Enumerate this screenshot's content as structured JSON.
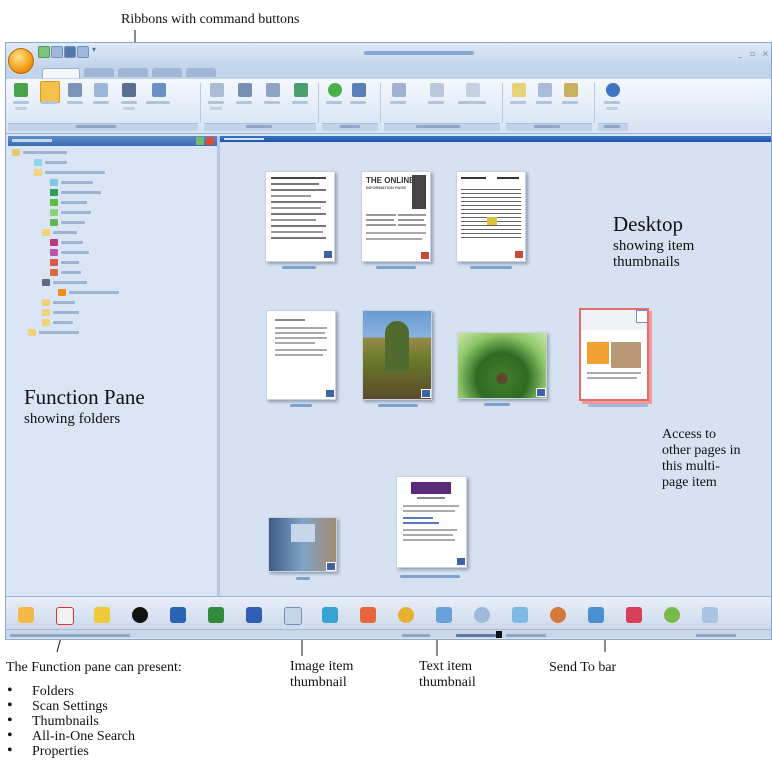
{
  "callouts": {
    "ribbons": "Ribbons with command buttons",
    "desktop_title": "Desktop",
    "desktop_sub1": "showing item",
    "desktop_sub2": "thumbnails",
    "function_pane_title": "Function Pane",
    "function_pane_sub": "showing folders",
    "access_line1": "Access to",
    "access_line2": "other pages in",
    "access_line3": "this multi-",
    "access_line4": "page item",
    "image_item_1": "Image item",
    "image_item_2": "thumbnail",
    "text_item_1": "Text item",
    "text_item_2": "thumbnail",
    "send_to_bar": "Send To bar"
  },
  "function_pane_can_present": {
    "heading": "The Function pane can present:",
    "items": [
      "Folders",
      "Scan Settings",
      "Thumbnails",
      "All-in-One Search",
      "Properties"
    ]
  },
  "thumbnails": {
    "newsletter_headline_1": "THE ONLINE",
    "newsletter_headline_2": "INFORMATION PAGE"
  },
  "colors": {
    "window_bg": "#dde7f4",
    "title_accent": "#3b6db4",
    "orb": "#f39a12",
    "multipage_border": "#e56a6a"
  },
  "icons": {
    "send_to": [
      "photo-editor-icon",
      "pdf-icon",
      "paint-icon",
      "media-icon",
      "photoshop-icon",
      "excel-icon",
      "word-icon",
      "notepad-icon",
      "image-viewer-icon",
      "powerpoint-icon",
      "browser-icon",
      "ftp-icon",
      "email-icon",
      "search-icon",
      "printer-icon",
      "network-icon",
      "chart-icon",
      "recycle-icon",
      "fax-icon"
    ]
  }
}
